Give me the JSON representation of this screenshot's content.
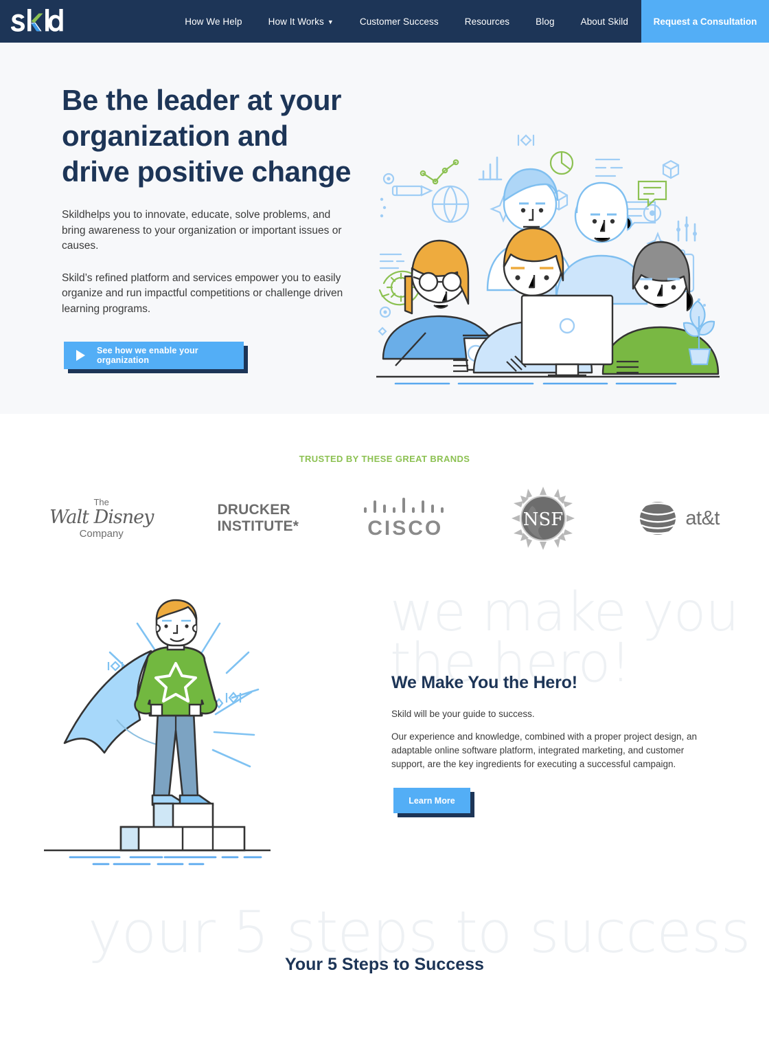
{
  "brand": {
    "name": "Skild",
    "navy": "#1d3557",
    "blue": "#53aef6",
    "green": "#8cc152"
  },
  "header": {
    "logo_text": "Skild",
    "nav": [
      {
        "label": "How We Help",
        "has_caret": false
      },
      {
        "label": "How It Works",
        "has_caret": true,
        "caret": "⌄"
      },
      {
        "label": "Customer Success",
        "has_caret": false
      },
      {
        "label": "Resources",
        "has_caret": false
      },
      {
        "label": "Blog",
        "has_caret": false
      },
      {
        "label": "About Skild",
        "has_caret": false
      }
    ],
    "cta": "Request a Consultation"
  },
  "hero": {
    "heading_line1": "Be the leader at your",
    "heading_line2": "organization and",
    "heading_line3": "drive positive change",
    "paragraph1": "Skildhelps you to innovate, educate, solve problems, and bring awareness to your organization or important issues or causes.",
    "paragraph2": "Skild’s refined platform and services empower you to easily organize and run impactful competitions or challenge driven learning programs.",
    "cta_label": "See how we enable your organization",
    "cta_icon": "play-icon",
    "illustration": "team-at-computer-illustration"
  },
  "brands": {
    "title": "TRUSTED BY THESE GREAT BRANDS",
    "logos": [
      {
        "name": "walt-disney-company-logo",
        "line1": "The",
        "line2": "Walt Disney",
        "line3": "Company"
      },
      {
        "name": "drucker-institute-logo",
        "line1": "DRUCKER",
        "line2": "INSTITUTE*"
      },
      {
        "name": "cisco-logo",
        "line1": "CISCO"
      },
      {
        "name": "nsf-logo",
        "line1": "NSF"
      },
      {
        "name": "att-logo",
        "line1": "at&t"
      }
    ]
  },
  "maker": {
    "watermark": "we make you\nthe hero!",
    "heading": "We Make You the Hero!",
    "paragraph1": "Skild will be your guide to success.",
    "paragraph2": "Our experience and knowledge, combined with a proper project design, an adaptable online software platform, integrated marketing, and customer support, are the key ingredients for executing a successful campaign.",
    "cta_label": "Learn More",
    "illustration": "superhero-on-podium-illustration"
  },
  "steps": {
    "watermark": "your 5 steps to success",
    "heading": "Your 5 Steps to Success"
  }
}
